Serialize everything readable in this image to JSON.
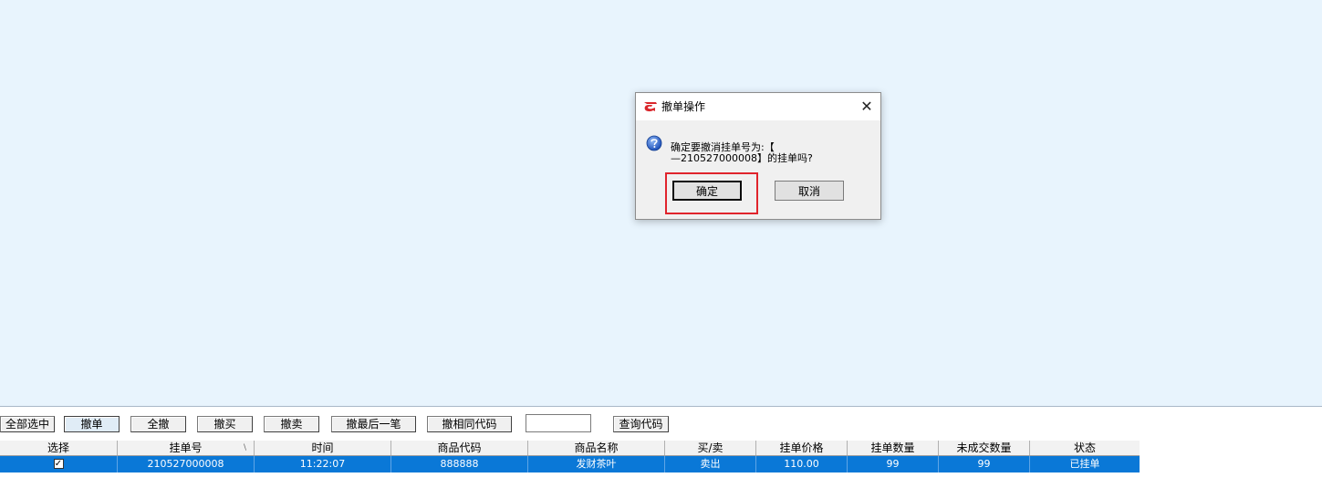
{
  "toolbar": {
    "buttons": [
      {
        "label": "全部选中"
      },
      {
        "label": "撤单"
      },
      {
        "label": "全撤"
      },
      {
        "label": "撤买"
      },
      {
        "label": "撤卖"
      },
      {
        "label": "撤最后一笔"
      },
      {
        "label": "撤相同代码"
      }
    ],
    "code_input_value": "",
    "query_button": "查询代码"
  },
  "table": {
    "columns": [
      "选择",
      "挂单号",
      "时间",
      "商品代码",
      "商品名称",
      "买/卖",
      "挂单价格",
      "挂单数量",
      "未成交数量",
      "状态"
    ],
    "sort_indicator": "\\",
    "rows": [
      {
        "checked_mark": "✓",
        "order_no": "210527000008",
        "time": "11:22:07",
        "code": "888888",
        "name": "发财茶叶",
        "side": "卖出",
        "price": "110.00",
        "qty": "99",
        "unfilled": "99",
        "status": "已挂单"
      }
    ]
  },
  "dialog": {
    "title": "撤单操作",
    "close_glyph": "✕",
    "message": "确定要撤消挂单号为:【\n—210527000008】的挂单吗?",
    "ok_label": "确定",
    "cancel_label": "取消",
    "icon": "question-icon"
  },
  "colors": {
    "workspace_bg": "#e8f4fd",
    "selected_row": "#0a78d7",
    "highlight_box": "#e0242c",
    "logo_red": "#d9262b"
  }
}
